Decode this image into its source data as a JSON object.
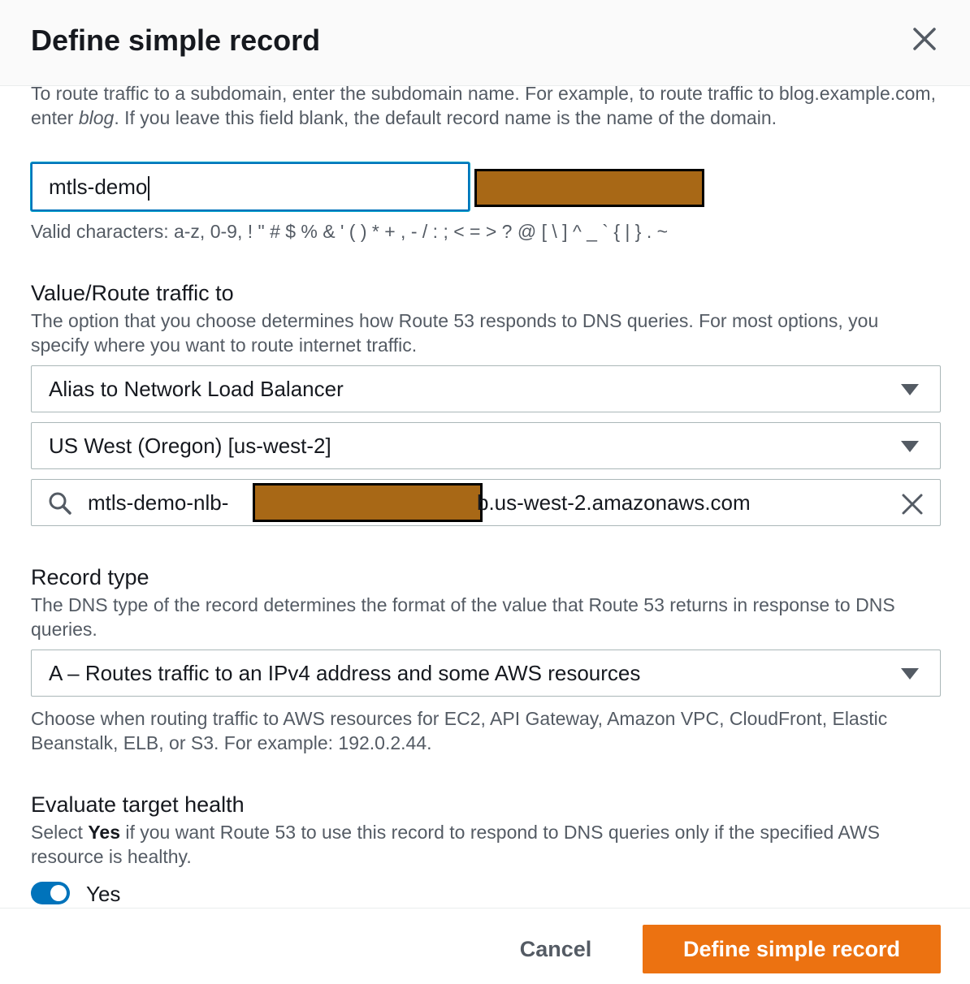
{
  "dialog": {
    "title": "Define simple record"
  },
  "record_name": {
    "help_pre": "To route traffic to a subdomain, enter the subdomain name. For example, to route traffic to blog.example.com, enter ",
    "help_em": "blog",
    "help_post": ". If you leave this field blank, the default record name is the name of the domain.",
    "value": "mtls-demo",
    "constraint": "Valid characters: a-z, 0-9, ! \" # $ % & ' ( ) * + , - / : ; < = > ? @ [ \\ ] ^ _ ` { | } . ~"
  },
  "value_route": {
    "label": "Value/Route traffic to",
    "description": "The option that you choose determines how Route 53 responds to DNS queries. For most options, you specify where you want to route internet traffic.",
    "endpoint_select": "Alias to Network Load Balancer",
    "region_select": "US West (Oregon) [us-west-2]",
    "search_prefix": "mtls-demo-nlb-",
    "search_suffix": "b.us-west-2.amazonaws.com"
  },
  "record_type": {
    "label": "Record type",
    "description": "The DNS type of the record determines the format of the value that Route 53 returns in response to DNS queries.",
    "selected": "A – Routes traffic to an IPv4 address and some AWS resources",
    "help": "Choose when routing traffic to AWS resources for EC2, API Gateway, Amazon VPC, CloudFront, Elastic Beanstalk, ELB, or S3. For example: 192.0.2.44."
  },
  "target_health": {
    "label": "Evaluate target health",
    "desc_pre": "Select ",
    "desc_strong": "Yes",
    "desc_post": " if you want Route 53 to use this record to respond to DNS queries only if the specified AWS resource is healthy.",
    "toggle_label": "Yes",
    "enabled": true
  },
  "footer": {
    "cancel_label": "Cancel",
    "submit_label": "Define simple record"
  },
  "colors": {
    "accent": "#0073bb",
    "primary_button": "#ec7211",
    "redaction": "#a86816"
  }
}
